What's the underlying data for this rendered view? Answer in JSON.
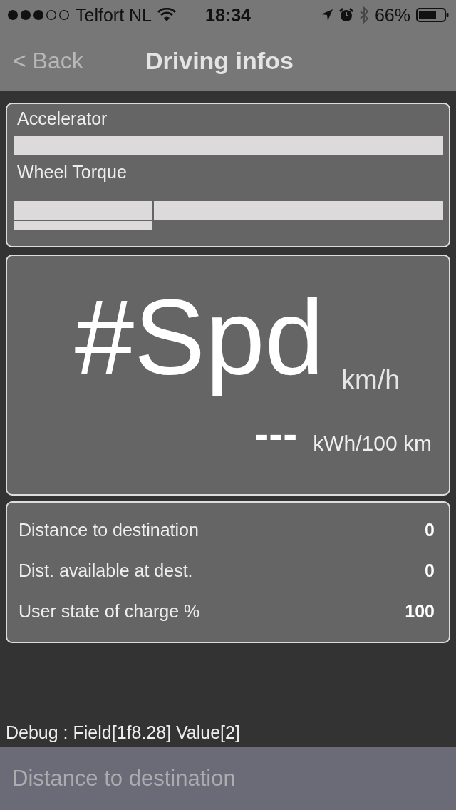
{
  "status_bar": {
    "carrier": "Telfort NL",
    "time": "18:34",
    "battery": "66%"
  },
  "nav": {
    "back": "< Back",
    "title": "Driving infos"
  },
  "gauges": [
    {
      "label": "Accelerator",
      "kind": "plain"
    },
    {
      "label": "Wheel Torque",
      "kind": "split",
      "level": 0.32
    }
  ],
  "speed": {
    "value": "#Spd",
    "unit": "km/h",
    "consumption": "---",
    "consumption_unit": "kWh/100 km"
  },
  "stats": [
    {
      "label": "Distance to destination",
      "value": "0"
    },
    {
      "label": "Dist. available at dest.",
      "value": "0"
    },
    {
      "label": "User state of charge %",
      "value": "100"
    }
  ],
  "debug": "Debug : Field[1f8.28] Value[2]",
  "bottom_bar": {
    "label": "Distance to destination"
  }
}
